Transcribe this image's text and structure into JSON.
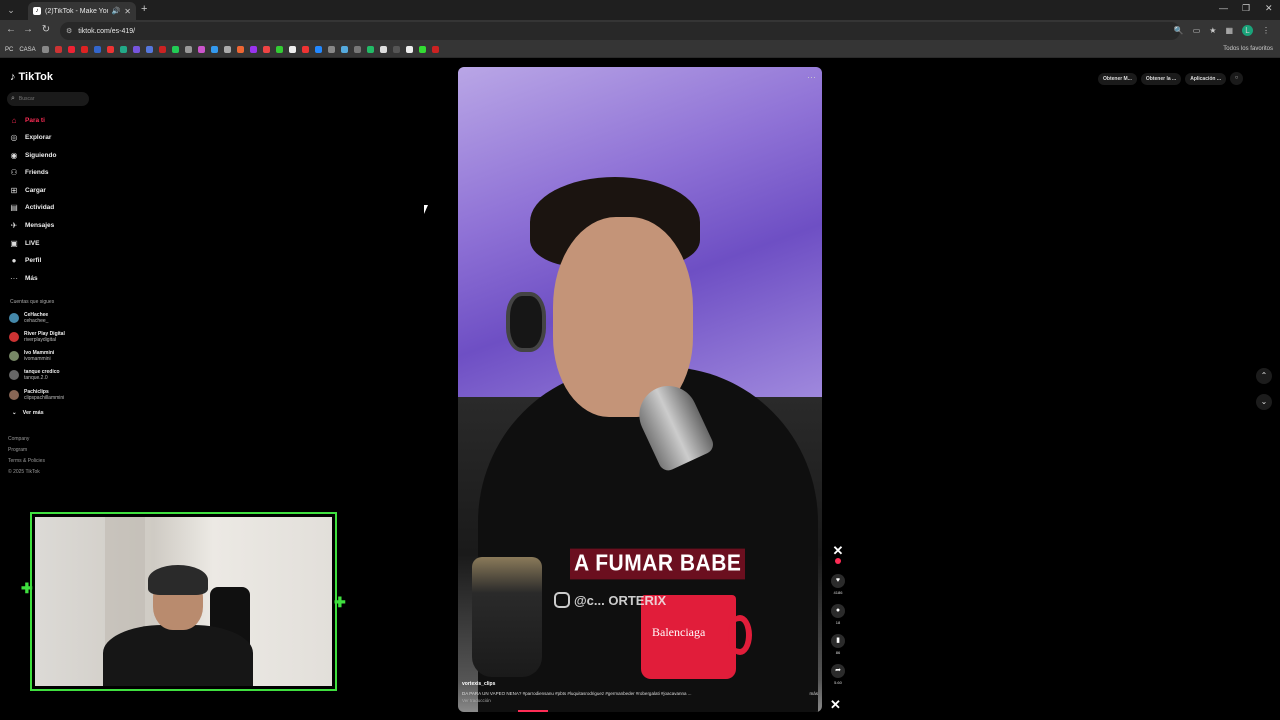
{
  "browser": {
    "tab_title": "(2)TikTok - Make Your Day",
    "url": "tiktok.com/es-419/",
    "bookmarks_label_pc": "PC",
    "bookmarks_label_casa": "CASA",
    "all_bookmarks": "Todos los favoritos",
    "profile_initial": "L"
  },
  "tiktok": {
    "logo": "TikTok",
    "search_placeholder": "Buscar",
    "nav": [
      {
        "label": "Para ti"
      },
      {
        "label": "Explorar"
      },
      {
        "label": "Siguiendo"
      },
      {
        "label": "Friends"
      },
      {
        "label": "Cargar"
      },
      {
        "label": "Actividad"
      },
      {
        "label": "Mensajes"
      },
      {
        "label": "LIVE"
      },
      {
        "label": "Perfil"
      },
      {
        "label": "Más"
      }
    ],
    "following_title": "Cuentas que sigues",
    "following": [
      {
        "name": "CeHachee",
        "handle": "cehachee_"
      },
      {
        "name": "River Play Digital",
        "handle": "riverplaydigital"
      },
      {
        "name": "Ivo Mammini",
        "handle": "ivomammini"
      },
      {
        "name": "tanque credico",
        "handle": "tanque.2.0"
      },
      {
        "name": "Pachiclips",
        "handle": "clipspachillammini"
      }
    ],
    "ver_mas": "Ver más",
    "footer": [
      "Company",
      "Program",
      "Terms & Policies",
      "© 2025 TikTok"
    ],
    "top_right": {
      "btn1": "Obtener M...",
      "btn2": "Obtener la ...",
      "btn3": "Aplicación ..."
    }
  },
  "video": {
    "caption": "A FUMAR BABE",
    "watermark": "@c... ORTERIX",
    "mug_brand": "Balenciaga",
    "username": "vortexis_clips",
    "description": "DA PARA UN VAPEO NENA? #parrodiensanu #pbts #luquitasrodriguez #germanbeder #robergalati #joacavanna ...",
    "more": "más",
    "translation": "Ver traducción",
    "likes": "4186",
    "comments": "18",
    "saves": "86",
    "shares": "5.60"
  },
  "colors": {
    "accent": "#fe2c55",
    "cam_border": "#3fe03f"
  }
}
